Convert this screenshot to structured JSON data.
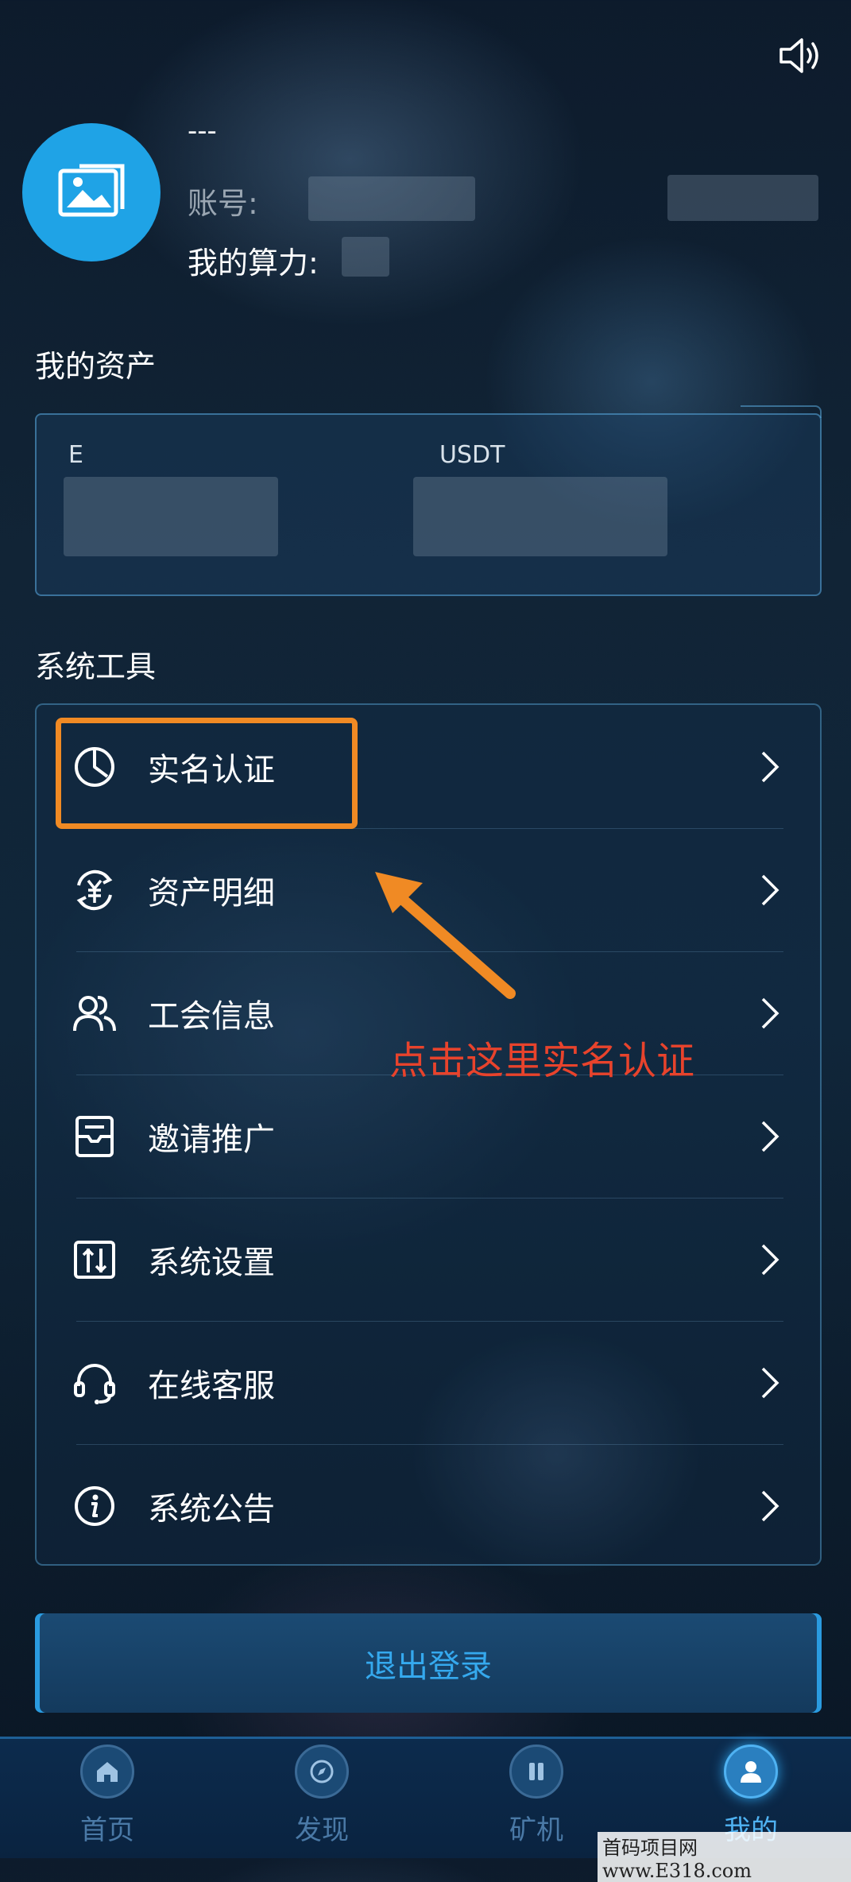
{
  "header": {
    "username": "---",
    "account_label": "账号:",
    "power_label": "我的算力:"
  },
  "assets": {
    "title": "我的资产",
    "columns": [
      {
        "label": "E"
      },
      {
        "label": "USDT"
      }
    ]
  },
  "tools": {
    "title": "系统工具",
    "items": [
      {
        "label": "实名认证",
        "icon": "clock-pie-icon"
      },
      {
        "label": "资产明细",
        "icon": "yuan-exchange-icon"
      },
      {
        "label": "工会信息",
        "icon": "users-icon"
      },
      {
        "label": "邀请推广",
        "icon": "mail-tray-icon"
      },
      {
        "label": "系统设置",
        "icon": "sliders-icon"
      },
      {
        "label": "在线客服",
        "icon": "headset-icon"
      },
      {
        "label": "系统公告",
        "icon": "info-icon"
      }
    ]
  },
  "annotation": {
    "text": "点击这里实名认证",
    "color": "#e8432c",
    "box_color": "#f08a24"
  },
  "logout": {
    "label": "退出登录"
  },
  "tabbar": {
    "items": [
      {
        "label": "首页",
        "icon": "home-icon",
        "active": false
      },
      {
        "label": "发现",
        "icon": "compass-icon",
        "active": false
      },
      {
        "label": "矿机",
        "icon": "miner-icon",
        "active": false
      },
      {
        "label": "我的",
        "icon": "user-icon",
        "active": true
      }
    ]
  },
  "watermark": "首码项目网 www.E318.com",
  "colors": {
    "accent": "#35a9ee",
    "avatar_bg": "#1fa3e6"
  }
}
